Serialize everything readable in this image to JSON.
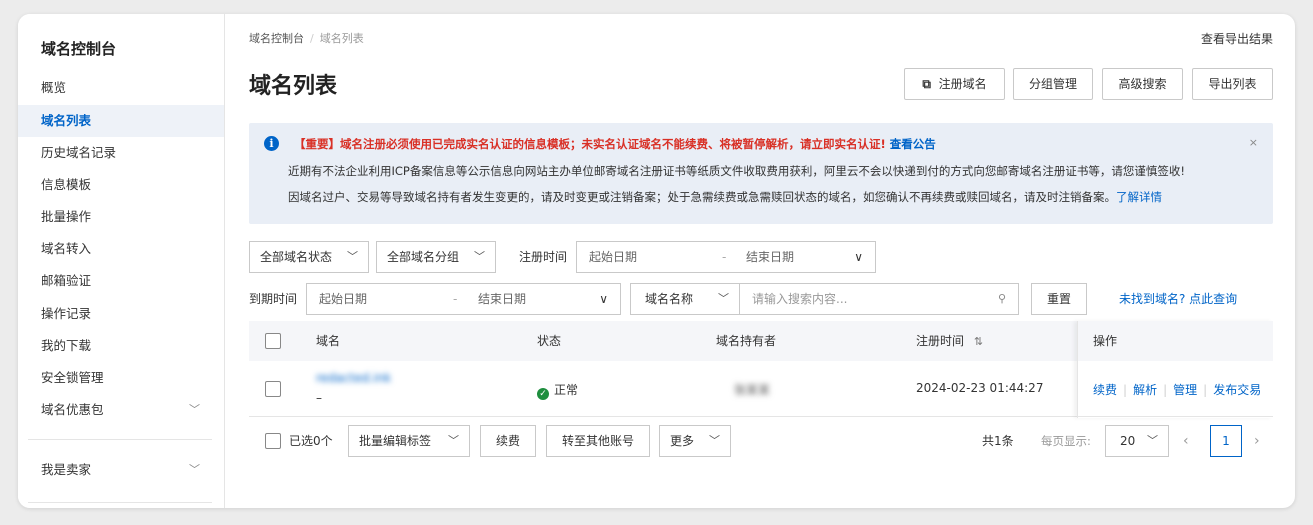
{
  "sidebar": {
    "title": "域名控制台",
    "items": [
      {
        "label": "概览"
      },
      {
        "label": "域名列表"
      },
      {
        "label": "历史域名记录"
      },
      {
        "label": "信息模板"
      },
      {
        "label": "批量操作"
      },
      {
        "label": "域名转入"
      },
      {
        "label": "邮箱验证"
      },
      {
        "label": "操作记录"
      },
      {
        "label": "我的下载"
      },
      {
        "label": "安全锁管理"
      },
      {
        "label": "域名优惠包"
      }
    ],
    "seller": "我是卖家",
    "active_item": "域名列表"
  },
  "breadcrumb": {
    "root": "域名控制台",
    "current": "域名列表"
  },
  "header": {
    "title": "域名列表",
    "export_result": "查看导出结果",
    "buttons": {
      "register": "注册域名",
      "group": "分组管理",
      "advanced": "高级搜索",
      "export": "导出列表"
    }
  },
  "notice": {
    "important": "【重要】域名注册必须使用已完成实名认证的信息模板；未实名认证域名不能续费、将被暂停解析，请立即实名认证!",
    "important_link": "查看公告",
    "line2": "近期有不法企业利用ICP备案信息等公示信息向网站主办单位邮寄域名注册证书等纸质文件收取费用获利，阿里云不会以快递到付的方式向您邮寄域名注册证书等，请您谨慎签收!",
    "line3": "因域名过户、交易等导致域名持有者发生变更的，请及时变更或注销备案；处于急需续费或急需赎回状态的域名，如您确认不再续费或赎回域名，请及时注销备案。",
    "line3_link": "了解详情",
    "close": "×"
  },
  "filters": {
    "status": "全部域名状态",
    "group": "全部域名分组",
    "reg_time_label": "注册时间",
    "reg_start": "起始日期",
    "reg_end": "结束日期",
    "exp_time_label": "到期时间",
    "exp_start": "起始日期",
    "exp_end": "结束日期",
    "search_field": "域名名称",
    "search_placeholder": "请输入搜索内容...",
    "reset": "重置",
    "not_found": "未找到域名? 点此查询",
    "dash": "-"
  },
  "table": {
    "columns": {
      "domain": "域名",
      "status": "状态",
      "owner": "域名持有者",
      "reg_time": "注册时间",
      "ops": "操作"
    },
    "sort_icon": "⇅",
    "rows": [
      {
        "domain_blurred": "redacted.ink",
        "domain_sub": "–",
        "status": "正常",
        "owner_blurred": "张某某",
        "reg_time": "2024-02-23 01:44:27",
        "ops": [
          "续费",
          "解析",
          "管理",
          "发布交易"
        ]
      }
    ]
  },
  "footer": {
    "selected": "已选0个",
    "batch_tag": "批量编辑标签",
    "renew": "续费",
    "transfer": "转至其他账号",
    "more": "更多",
    "total": "共1条",
    "per_page_label": "每页显示:",
    "per_page": "20",
    "page": "1"
  },
  "colors": {
    "accent": "#0064c8",
    "danger": "#d93026",
    "success": "#1e8e3e",
    "notice_bg": "#e9eef6"
  }
}
